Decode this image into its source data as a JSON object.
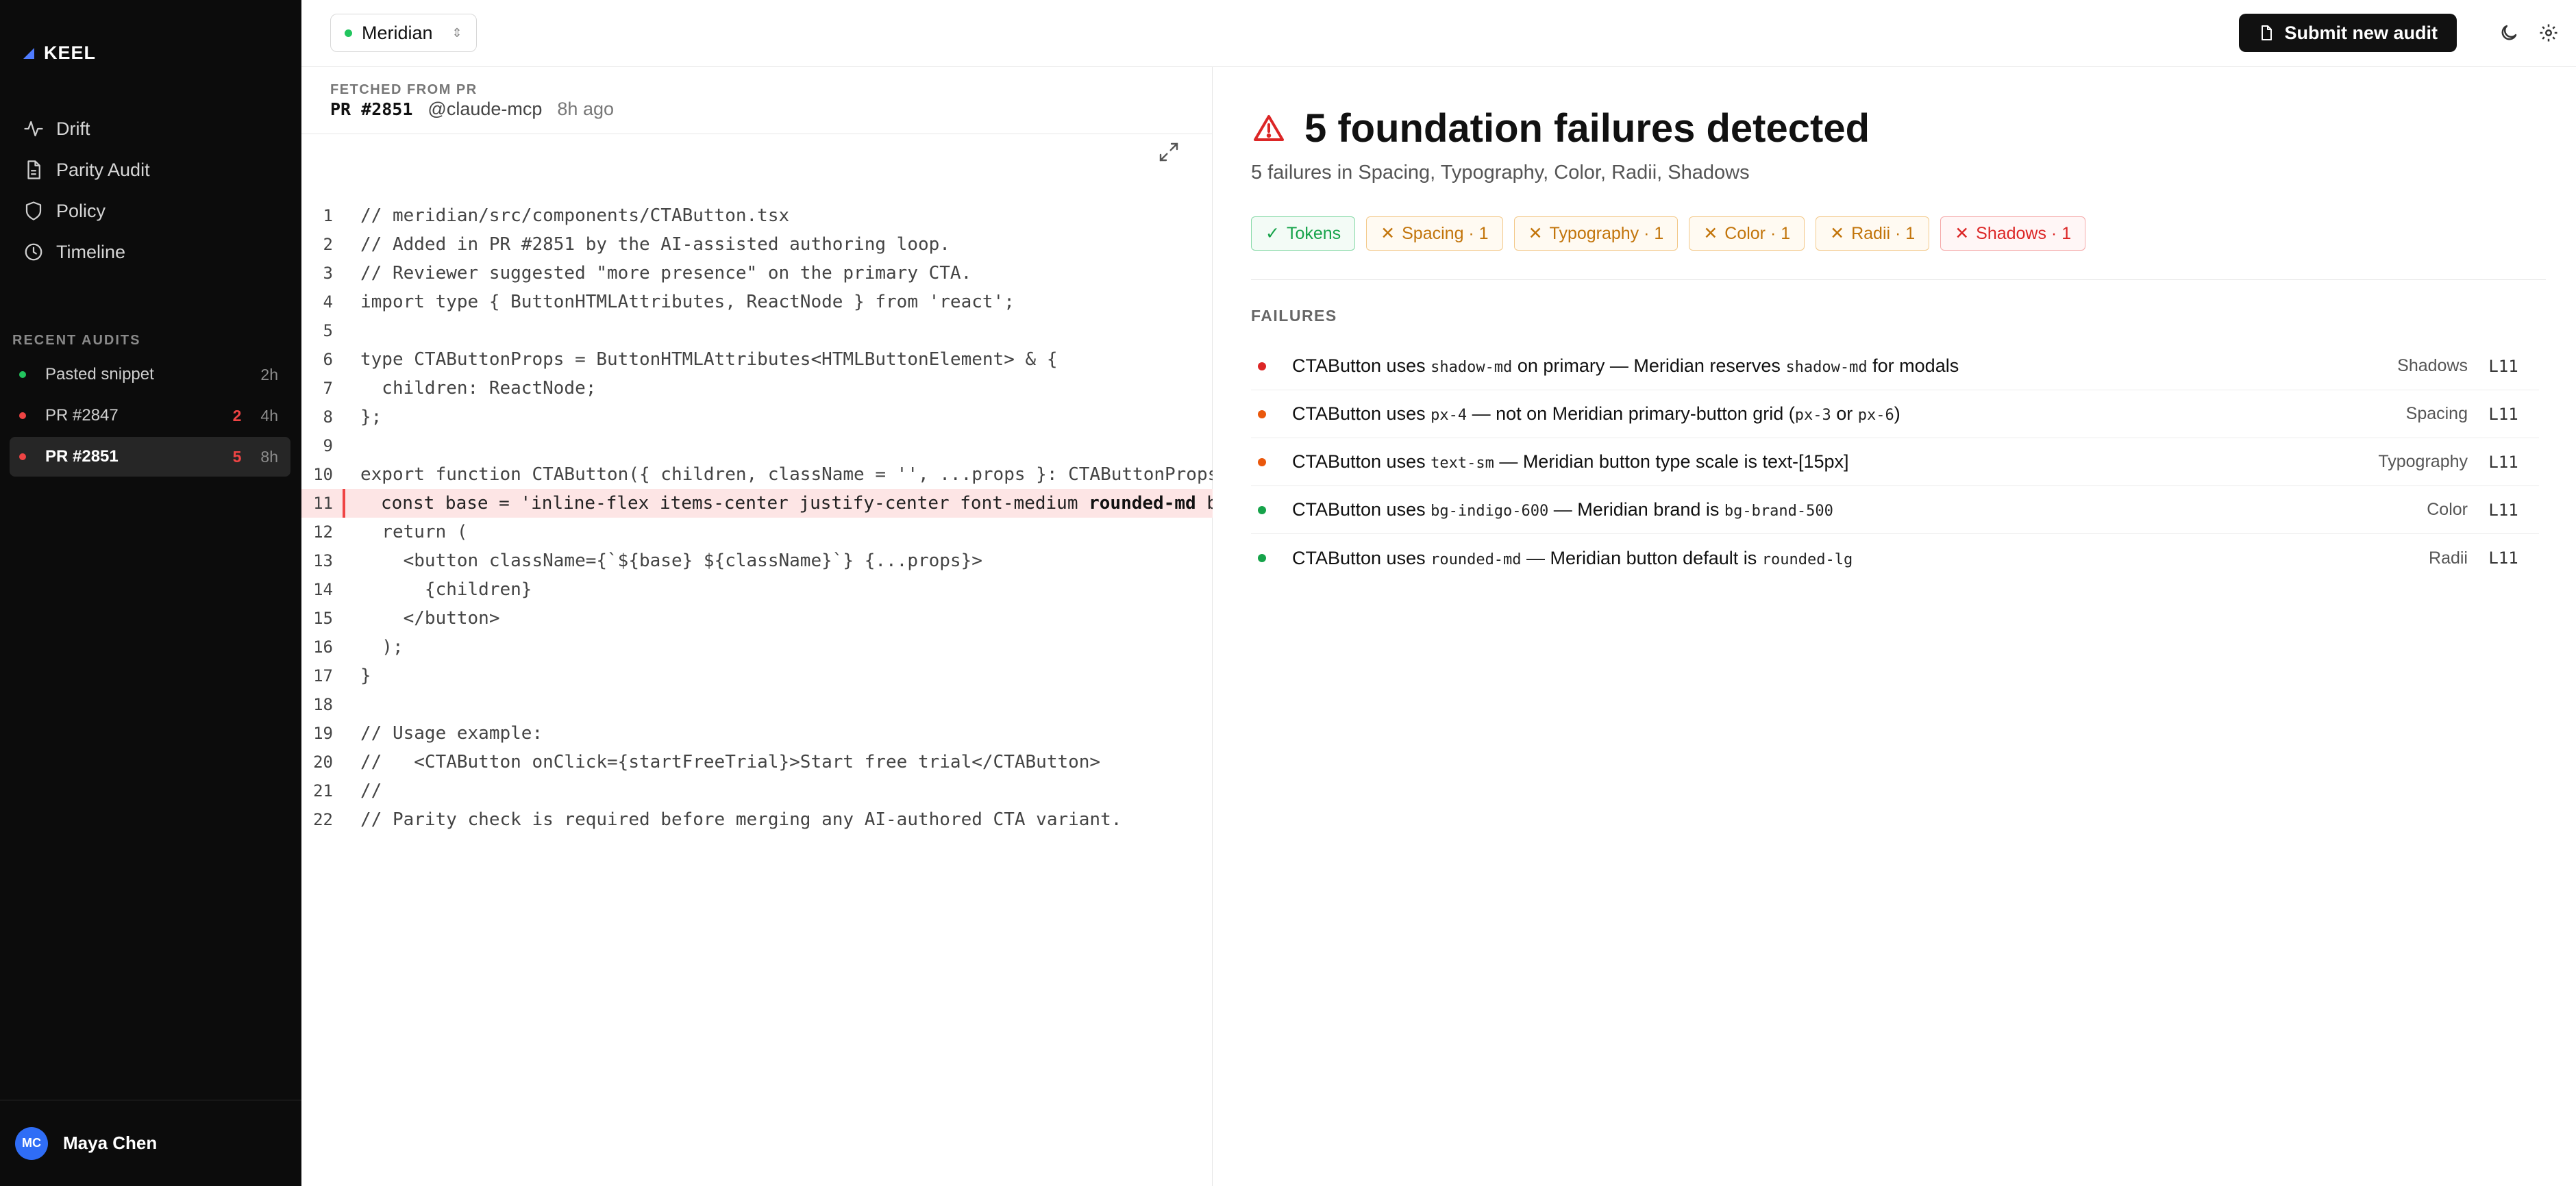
{
  "app": {
    "name": "KEEL"
  },
  "sidebar": {
    "nav": [
      {
        "label": "Drift",
        "icon": "activity-icon"
      },
      {
        "label": "Parity Audit",
        "icon": "document-icon"
      },
      {
        "label": "Policy",
        "icon": "shield-icon"
      },
      {
        "label": "Timeline",
        "icon": "clock-icon"
      }
    ],
    "recent_title": "RECENT AUDITS",
    "recent": [
      {
        "label": "Pasted snippet",
        "count": "",
        "time": "2h",
        "status_color": "#22c55e"
      },
      {
        "label": "PR #2847",
        "count": "2",
        "time": "4h",
        "status_color": "#ef4444"
      },
      {
        "label": "PR #2851",
        "count": "5",
        "time": "8h",
        "status_color": "#ef4444",
        "active": true
      }
    ],
    "user": {
      "initials": "MC",
      "name": "Maya Chen"
    }
  },
  "topbar": {
    "project": "Meridian",
    "submit_label": "Submit new audit"
  },
  "source": {
    "fetched_label": "FETCHED FROM PR",
    "pr": "PR #2851",
    "author": "@claude-mcp",
    "time": "8h ago"
  },
  "code": {
    "highlight_line": 11,
    "lines": [
      "// meridian/src/components/CTAButton.tsx",
      "// Added in PR #2851 by the AI-assisted authoring loop.",
      "// Reviewer suggested \"more presence\" on the primary CTA.",
      "import type { ButtonHTMLAttributes, ReactNode } from 'react';",
      "",
      "type CTAButtonProps = ButtonHTMLAttributes<HTMLButtonElement> & {",
      "  children: ReactNode;",
      "};",
      "",
      "export function CTAButton({ children, className = '', ...props }: CTAButtonProps",
      "const base = 'inline-flex items-center justify-center font-medium rounded-md b",
      "  return (",
      "    <button className={`${base} ${className}`} {...props}>",
      "      {children}",
      "    </button>",
      "  );",
      "}",
      "",
      "// Usage example:",
      "//   <CTAButton onClick={startFreeTrial}>Start free trial</CTAButton>",
      "//",
      "// Parity check is required before merging any AI-authored CTA variant."
    ]
  },
  "results": {
    "title": "5 foundation failures detected",
    "subtitle": "5 failures in Spacing, Typography, Color, Radii, Shadows",
    "chips": [
      {
        "label": "Tokens",
        "kind": "ok"
      },
      {
        "label": "Spacing · 1",
        "kind": "warn"
      },
      {
        "label": "Typography · 1",
        "kind": "warn"
      },
      {
        "label": "Color · 1",
        "kind": "warn"
      },
      {
        "label": "Radii · 1",
        "kind": "warn"
      },
      {
        "label": "Shadows · 1",
        "kind": "err"
      }
    ],
    "failures_title": "FAILURES",
    "failures": [
      {
        "parts": [
          "CTAButton uses ",
          "shadow-md",
          " on primary — Meridian reserves ",
          "shadow-md",
          " for modals"
        ],
        "category": "Shadows",
        "line": "L11",
        "color": "#dc2626"
      },
      {
        "parts": [
          "CTAButton uses ",
          "px-4",
          " — not on Meridian primary-button grid (",
          "px-3",
          " or ",
          "px-6",
          ")"
        ],
        "category": "Spacing",
        "line": "L11",
        "color": "#ea580c"
      },
      {
        "parts": [
          "CTAButton uses ",
          "text-sm",
          " — Meridian button type scale is text-[15px]"
        ],
        "category": "Typography",
        "line": "L11",
        "color": "#ea580c"
      },
      {
        "parts": [
          "CTAButton uses ",
          "bg-indigo-600",
          " — Meridian brand is ",
          "bg-brand-500"
        ],
        "category": "Color",
        "line": "L11",
        "color": "#16a34a"
      },
      {
        "parts": [
          "CTAButton uses ",
          "rounded-md",
          " — Meridian button default is ",
          "rounded-lg"
        ],
        "category": "Radii",
        "line": "L11",
        "color": "#16a34a"
      }
    ]
  }
}
